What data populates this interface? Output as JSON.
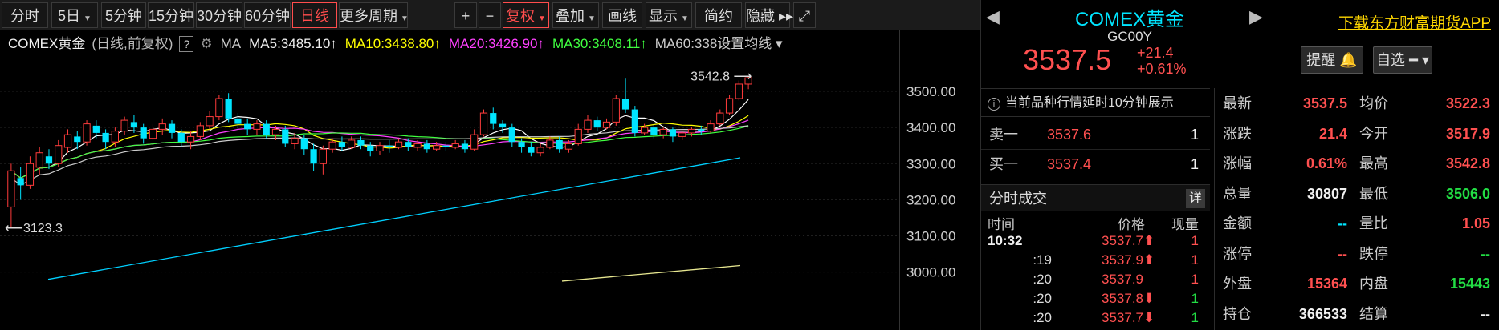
{
  "toolbar": {
    "left_buttons": [
      {
        "label": "分时"
      },
      {
        "label": "5日",
        "dropdown": true
      },
      {
        "label": "5分钟"
      },
      {
        "label": "15分钟"
      },
      {
        "label": "30分钟"
      },
      {
        "label": "60分钟"
      },
      {
        "label": "日线",
        "active": true
      },
      {
        "label": "更多周期",
        "dropdown": true
      }
    ],
    "right_buttons": [
      {
        "label": "+"
      },
      {
        "label": "−"
      },
      {
        "label": "复权",
        "dropdown": true,
        "active": true
      },
      {
        "label": "叠加",
        "dropdown": true
      },
      {
        "label": "画线"
      },
      {
        "label": "显示",
        "dropdown": true
      },
      {
        "label": "简约"
      },
      {
        "label": "隐藏 ▸▸"
      },
      {
        "label": "⤢"
      }
    ]
  },
  "legend": {
    "title": "COMEX黄金",
    "subtitle": "(日线,前复权)",
    "help": "?",
    "ma_label": "MA",
    "ma5": "MA5:3485.10↑",
    "ma10": "MA10:3438.80↑",
    "ma20": "MA20:3426.90↑",
    "ma30": "MA30:3408.11↑",
    "ma60": "MA60:338",
    "settings": "设置均线 ▾"
  },
  "chart_data": {
    "type": "candlestick",
    "y_ticks": [
      "3500.00",
      "3400.00",
      "3300.00",
      "3200.00",
      "3100.00",
      "3000.00"
    ],
    "ylim": [
      2990,
      3570
    ],
    "max_label": "3542.8",
    "min_label": "3123.3",
    "candles": [
      [
        3180,
        3280,
        3123,
        3300
      ],
      [
        3260,
        3240,
        3200,
        3290
      ],
      [
        3240,
        3300,
        3230,
        3320
      ],
      [
        3290,
        3330,
        3270,
        3345
      ],
      [
        3320,
        3300,
        3285,
        3340
      ],
      [
        3300,
        3350,
        3290,
        3365
      ],
      [
        3345,
        3380,
        3330,
        3395
      ],
      [
        3375,
        3360,
        3340,
        3390
      ],
      [
        3360,
        3410,
        3350,
        3420
      ],
      [
        3405,
        3385,
        3370,
        3420
      ],
      [
        3385,
        3360,
        3340,
        3395
      ],
      [
        3360,
        3390,
        3345,
        3400
      ],
      [
        3390,
        3420,
        3380,
        3430
      ],
      [
        3415,
        3400,
        3385,
        3435
      ],
      [
        3400,
        3370,
        3355,
        3410
      ],
      [
        3370,
        3395,
        3365,
        3410
      ],
      [
        3395,
        3410,
        3380,
        3425
      ],
      [
        3410,
        3385,
        3370,
        3420
      ],
      [
        3385,
        3360,
        3345,
        3395
      ],
      [
        3360,
        3375,
        3340,
        3390
      ],
      [
        3375,
        3405,
        3365,
        3415
      ],
      [
        3405,
        3430,
        3395,
        3445
      ],
      [
        3430,
        3480,
        3420,
        3490
      ],
      [
        3480,
        3425,
        3415,
        3495
      ],
      [
        3425,
        3410,
        3395,
        3440
      ],
      [
        3410,
        3395,
        3380,
        3425
      ],
      [
        3395,
        3410,
        3380,
        3420
      ],
      [
        3410,
        3380,
        3370,
        3420
      ],
      [
        3380,
        3395,
        3365,
        3405
      ],
      [
        3395,
        3355,
        3345,
        3405
      ],
      [
        3355,
        3370,
        3340,
        3385
      ],
      [
        3370,
        3340,
        3325,
        3380
      ],
      [
        3340,
        3300,
        3280,
        3355
      ],
      [
        3300,
        3340,
        3270,
        3350
      ],
      [
        3340,
        3360,
        3330,
        3370
      ],
      [
        3360,
        3345,
        3335,
        3375
      ],
      [
        3345,
        3365,
        3340,
        3375
      ],
      [
        3365,
        3350,
        3340,
        3375
      ],
      [
        3350,
        3335,
        3320,
        3360
      ],
      [
        3335,
        3350,
        3325,
        3360
      ],
      [
        3350,
        3345,
        3330,
        3365
      ],
      [
        3345,
        3360,
        3340,
        3370
      ],
      [
        3360,
        3345,
        3335,
        3370
      ],
      [
        3345,
        3355,
        3335,
        3365
      ],
      [
        3355,
        3340,
        3330,
        3365
      ],
      [
        3340,
        3350,
        3335,
        3360
      ],
      [
        3350,
        3345,
        3335,
        3360
      ],
      [
        3345,
        3355,
        3340,
        3365
      ],
      [
        3355,
        3340,
        3330,
        3365
      ],
      [
        3340,
        3380,
        3335,
        3395
      ],
      [
        3380,
        3440,
        3375,
        3450
      ],
      [
        3440,
        3410,
        3395,
        3455
      ],
      [
        3410,
        3400,
        3385,
        3420
      ],
      [
        3400,
        3360,
        3345,
        3410
      ],
      [
        3360,
        3345,
        3330,
        3370
      ],
      [
        3345,
        3330,
        3320,
        3360
      ],
      [
        3330,
        3345,
        3320,
        3355
      ],
      [
        3345,
        3365,
        3340,
        3375
      ],
      [
        3365,
        3340,
        3330,
        3375
      ],
      [
        3340,
        3355,
        3330,
        3365
      ],
      [
        3355,
        3395,
        3350,
        3410
      ],
      [
        3395,
        3420,
        3385,
        3435
      ],
      [
        3420,
        3400,
        3390,
        3430
      ],
      [
        3400,
        3415,
        3395,
        3425
      ],
      [
        3415,
        3480,
        3405,
        3490
      ],
      [
        3480,
        3450,
        3440,
        3535
      ],
      [
        3450,
        3385,
        3375,
        3460
      ],
      [
        3385,
        3400,
        3380,
        3410
      ],
      [
        3400,
        3380,
        3370,
        3410
      ],
      [
        3380,
        3395,
        3370,
        3400
      ],
      [
        3395,
        3375,
        3360,
        3400
      ],
      [
        3375,
        3385,
        3365,
        3390
      ],
      [
        3385,
        3395,
        3375,
        3400
      ],
      [
        3395,
        3390,
        3380,
        3405
      ],
      [
        3390,
        3410,
        3385,
        3420
      ],
      [
        3410,
        3440,
        3405,
        3450
      ],
      [
        3440,
        3480,
        3435,
        3490
      ],
      [
        3480,
        3520,
        3475,
        3530
      ],
      [
        3520,
        3537.5,
        3506,
        3542.8
      ]
    ],
    "ma_series": [
      {
        "name": "MA5",
        "color": "#ffffff"
      },
      {
        "name": "MA10",
        "color": "#ffff00"
      },
      {
        "name": "MA20",
        "color": "#ff40ff"
      },
      {
        "name": "MA30",
        "color": "#40ff40"
      },
      {
        "name": "MA60",
        "color": "#cccccc"
      }
    ]
  },
  "header": {
    "name": "COMEX黄金",
    "code": "GC00Y",
    "price": "3537.5",
    "change": "+21.4",
    "change_pct": "+0.61%",
    "app_link": "下载东方财富期货APP",
    "remind_btn": "提醒 🔔",
    "watch_btn": "自选 ━ ▾"
  },
  "notice": "当前品种行情延时10分钟展示",
  "orderbook": [
    {
      "label": "卖一",
      "price": "3537.6",
      "volume": "1"
    },
    {
      "label": "买一",
      "price": "3537.4",
      "volume": "1"
    }
  ],
  "ticks": {
    "title": "分时成交",
    "detail": "详",
    "col_time": "时间",
    "col_price": "价格",
    "col_vol": "现量",
    "rows": [
      {
        "time": "10:32",
        "price": "3537.7⬆",
        "vol": "1",
        "dir": "up"
      },
      {
        "time": ":19",
        "price": "3537.9⬆",
        "vol": "1",
        "dir": "up"
      },
      {
        "time": ":20",
        "price": "3537.9",
        "vol": "1",
        "dir": "up"
      },
      {
        "time": ":20",
        "price": "3537.8⬇",
        "vol": "1",
        "dir": "down"
      },
      {
        "time": ":20",
        "price": "3537.7⬇",
        "vol": "1",
        "dir": "down"
      }
    ]
  },
  "quote": [
    {
      "k1": "最新",
      "v1": "3537.5",
      "c1": "red",
      "k2": "均价",
      "v2": "3522.3",
      "c2": "red"
    },
    {
      "k1": "涨跌",
      "v1": "21.4",
      "c1": "red",
      "k2": "今开",
      "v2": "3517.9",
      "c2": "red"
    },
    {
      "k1": "涨幅",
      "v1": "0.61%",
      "c1": "red",
      "k2": "最高",
      "v2": "3542.8",
      "c2": "red"
    },
    {
      "k1": "总量",
      "v1": "30807",
      "c1": "wht",
      "k2": "最低",
      "v2": "3506.0",
      "c2": "grn"
    },
    {
      "k1": "金额",
      "v1": "--",
      "c1": "cy",
      "k2": "量比",
      "v2": "1.05",
      "c2": "red"
    },
    {
      "k1": "涨停",
      "v1": "--",
      "c1": "red",
      "k2": "跌停",
      "v2": "--",
      "c2": "grn"
    },
    {
      "k1": "外盘",
      "v1": "15364",
      "c1": "red",
      "k2": "内盘",
      "v2": "15443",
      "c2": "grn"
    },
    {
      "k1": "持仓",
      "v1": "366533",
      "c1": "wht",
      "k2": "结算",
      "v2": "--",
      "c2": "wht"
    }
  ]
}
